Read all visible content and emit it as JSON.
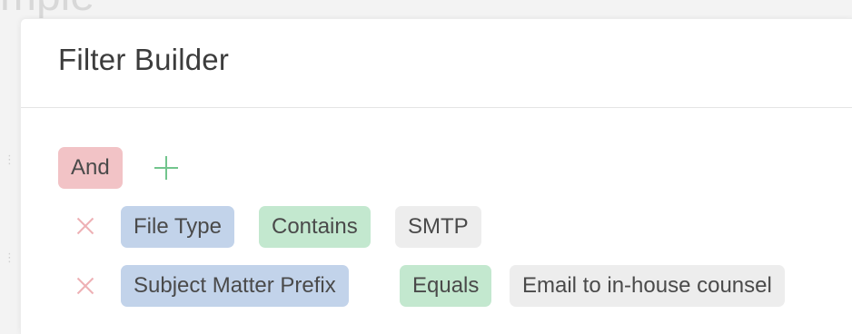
{
  "background": {
    "title_fragment": "mple"
  },
  "dialog": {
    "title": "Filter Builder"
  },
  "group": {
    "operator": "And"
  },
  "conditions": [
    {
      "field": "File Type",
      "operator": "Contains",
      "value": "SMTP"
    },
    {
      "field": "Subject Matter Prefix",
      "operator": "Equals",
      "value": "Email to in-house counsel"
    }
  ],
  "colors": {
    "group_operator": "#f2c3c6",
    "field_chip": "#c2d3ea",
    "operator_chip": "#c3e8cf",
    "value_chip": "#ededed",
    "add_icon": "#72c58d",
    "remove_icon": "#eeb0b4"
  },
  "icons": {
    "add": "plus-icon",
    "remove": "close-icon"
  }
}
